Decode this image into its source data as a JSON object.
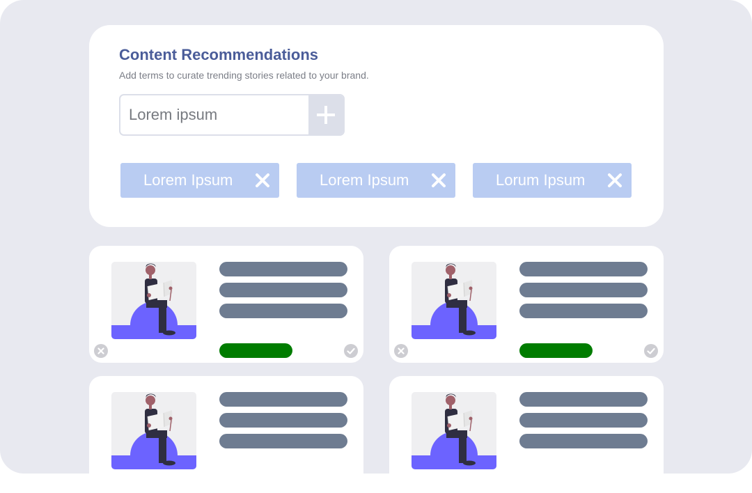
{
  "header": {
    "title": "Content Recommendations",
    "subtitle": "Add terms to curate trending stories related to your brand."
  },
  "search": {
    "placeholder": "Lorem ipsum",
    "add_icon": "plus-icon"
  },
  "tags": [
    {
      "label": "Lorem Ipsum",
      "icon": "close-icon"
    },
    {
      "label": "Lorem Ipsum",
      "icon": "close-icon"
    },
    {
      "label": "Lorum Ipsum",
      "icon": "close-icon"
    }
  ],
  "cards": [
    {
      "image": "person-reading-illustration",
      "status_color": "#007c00",
      "dismiss_icon": "x-circle-icon",
      "approve_icon": "check-circle-icon"
    },
    {
      "image": "person-reading-illustration",
      "status_color": "#007c00",
      "dismiss_icon": "x-circle-icon",
      "approve_icon": "check-circle-icon"
    },
    {
      "image": "person-reading-illustration"
    },
    {
      "image": "person-reading-illustration"
    }
  ],
  "colors": {
    "accent_title": "#4a5c99",
    "tag_bg": "#b9ccf2",
    "text_line": "#6e7c91",
    "status_green": "#007c00",
    "illustration_purple": "#6c63ff"
  }
}
